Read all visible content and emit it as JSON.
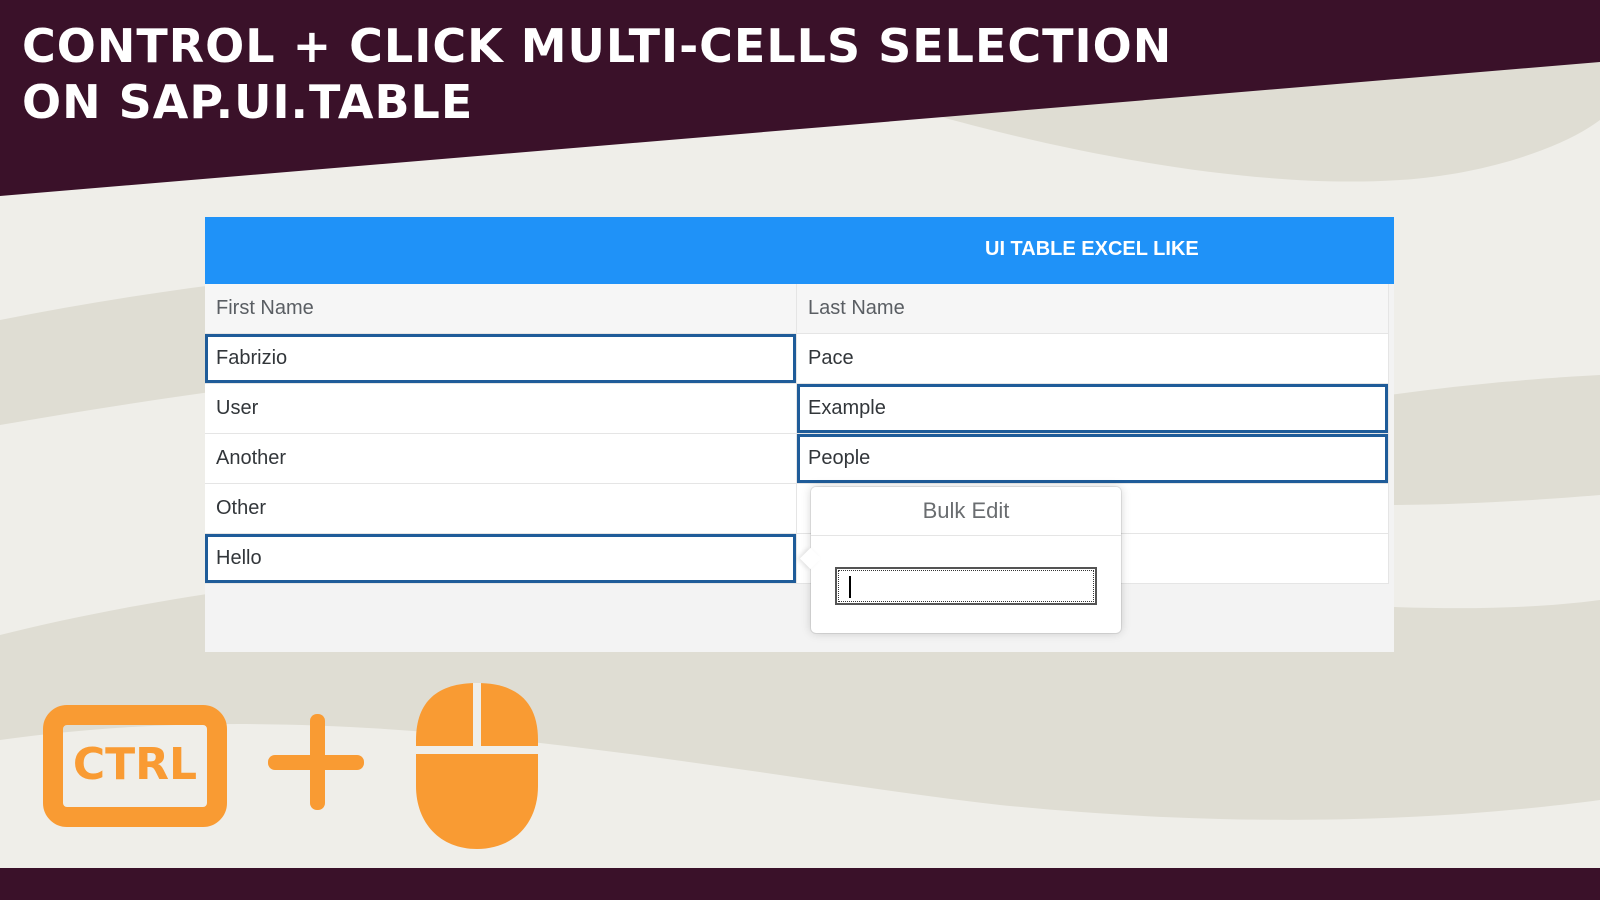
{
  "colors": {
    "background": "#efeee9",
    "wave": "#dfddd3",
    "dark_band": "#3a1129",
    "toolbar_blue": "#1f92f8",
    "selection_border": "#1f5c99",
    "accent_orange": "#f99b33"
  },
  "headline": {
    "line1": "CONTROL + CLICK MULTI-CELLS SELECTION",
    "line2": "ON SAP.UI.TABLE"
  },
  "table": {
    "title": "UI TABLE EXCEL LIKE",
    "columns": [
      "First Name",
      "Last Name"
    ],
    "rows": [
      {
        "first": "Fabrizio",
        "last": "Pace",
        "first_selected": true,
        "last_selected": false
      },
      {
        "first": "User",
        "last": "Example",
        "first_selected": false,
        "last_selected": true
      },
      {
        "first": "Another",
        "last": "People",
        "first_selected": false,
        "last_selected": true
      },
      {
        "first": "Other",
        "last": "",
        "first_selected": false,
        "last_selected": false
      },
      {
        "first": "Hello",
        "last": "",
        "first_selected": true,
        "last_selected": false
      }
    ]
  },
  "bulk_edit": {
    "title": "Bulk Edit",
    "input_value": ""
  },
  "icons": {
    "key": "ctrl-key-icon",
    "key_label": "CTRL",
    "plus": "plus-icon",
    "mouse": "mouse-icon"
  }
}
